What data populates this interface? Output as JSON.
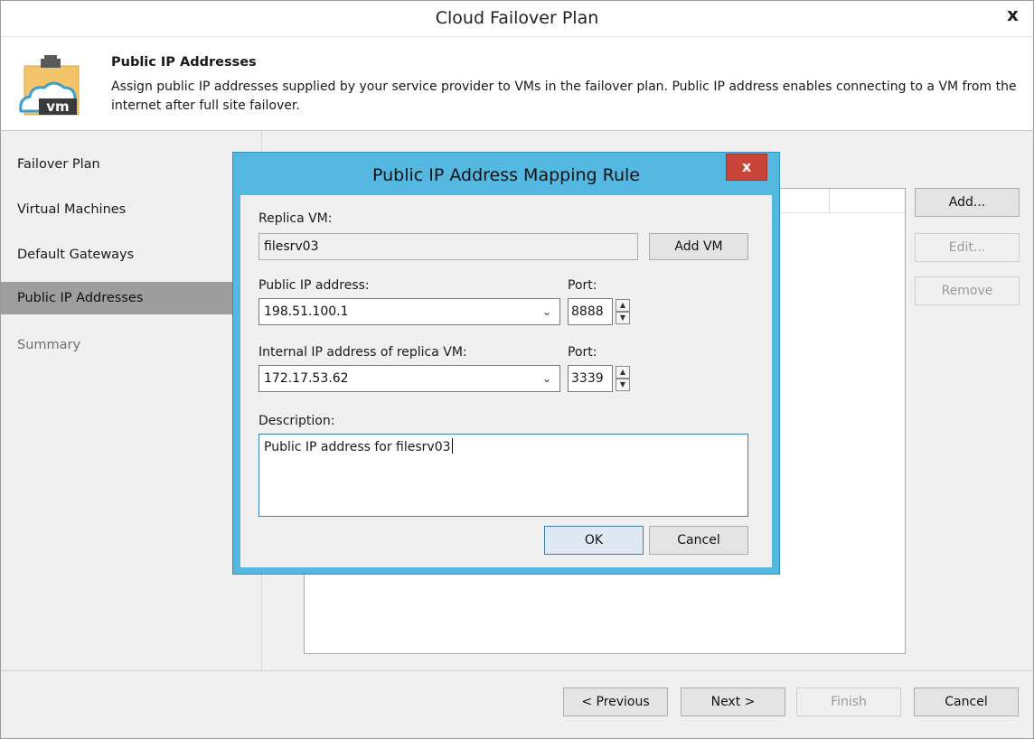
{
  "window": {
    "title": "Cloud Failover Plan",
    "close_glyph": "x"
  },
  "header": {
    "title": "Public IP Addresses",
    "description": "Assign public IP addresses supplied by your service provider to VMs in the failover plan. Public IP address enables connecting to a VM from the internet after full site failover.",
    "logo_text": "vm",
    "logo_icon": "cloud-vm-icon"
  },
  "sidebar": {
    "items": [
      {
        "label": "Failover Plan",
        "state": "normal"
      },
      {
        "label": "Virtual Machines",
        "state": "normal"
      },
      {
        "label": "Default Gateways",
        "state": "normal"
      },
      {
        "label": "Public IP Addresses",
        "state": "active"
      },
      {
        "label": "Summary",
        "state": "disabled"
      }
    ]
  },
  "side_buttons": {
    "add": "Add...",
    "edit": "Edit...",
    "remove": "Remove"
  },
  "footer": {
    "previous": "< Previous",
    "next": "Next >",
    "finish": "Finish",
    "cancel": "Cancel"
  },
  "dialog": {
    "title": "Public IP Address Mapping Rule",
    "close_glyph": "x",
    "replica_vm_label": "Replica VM:",
    "replica_vm_value": "filesrv03",
    "add_vm_button": "Add VM",
    "public_ip_label": "Public IP address:",
    "public_ip_value": "198.51.100.1",
    "public_port_label": "Port:",
    "public_port_value": "8888",
    "internal_ip_label": "Internal IP address of replica VM:",
    "internal_ip_value": "172.17.53.62",
    "internal_port_label": "Port:",
    "internal_port_value": "3339",
    "description_label": "Description:",
    "description_value": "Public IP address for filesrv03",
    "ok_button": "OK",
    "cancel_button": "Cancel"
  },
  "colors": {
    "dialog_frame": "#54b8e0",
    "dialog_close": "#c94438",
    "sidebar_active": "#9e9e9e"
  }
}
